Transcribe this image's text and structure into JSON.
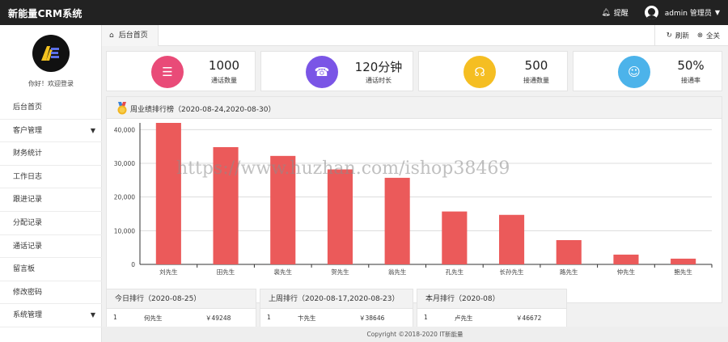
{
  "app": {
    "title": "新能量CRM系统"
  },
  "topbar": {
    "notice_label": "提醒",
    "user_label": "admin 管理员"
  },
  "sidebar": {
    "welcome": "你好！欢迎登录",
    "items": [
      {
        "label": "后台首页",
        "has_arrow": false
      },
      {
        "label": "客户管理",
        "has_arrow": true
      },
      {
        "label": "财务统计",
        "has_arrow": false
      },
      {
        "label": "工作日志",
        "has_arrow": false
      },
      {
        "label": "跟进记录",
        "has_arrow": false
      },
      {
        "label": "分配记录",
        "has_arrow": false
      },
      {
        "label": "通话记录",
        "has_arrow": false
      },
      {
        "label": "留言板",
        "has_arrow": false
      },
      {
        "label": "修改密码",
        "has_arrow": false
      },
      {
        "label": "系统管理",
        "has_arrow": true
      }
    ]
  },
  "tabs": {
    "home": "后台首页",
    "refresh": "刷新",
    "close_all": "全关"
  },
  "stats": [
    {
      "value": "1000",
      "label": "通话数量",
      "color": "#e94b78",
      "icon": "document-icon"
    },
    {
      "value": "120分钟",
      "label": "通话时长",
      "color": "#7a55e6",
      "icon": "phone-icon"
    },
    {
      "value": "500",
      "label": "接通数量",
      "color": "#f5be22",
      "icon": "headset-icon"
    },
    {
      "value": "50%",
      "label": "接通率",
      "color": "#4cb3ea",
      "icon": "user-card-icon"
    }
  ],
  "chart_panel": {
    "title": "周业绩排行榜（2020-08-24,2020-08-30）"
  },
  "chart_data": {
    "type": "bar",
    "categories": [
      "刘先生",
      "田先生",
      "裴先生",
      "贺先生",
      "翁先生",
      "孔先生",
      "长孙先生",
      "路先生",
      "仲先生",
      "鲍先生"
    ],
    "values": [
      42000,
      34800,
      32200,
      28200,
      25700,
      15700,
      14700,
      7200,
      2900,
      1700
    ],
    "ylim": [
      0,
      42000
    ],
    "yticks": [
      0,
      10000,
      20000,
      30000,
      40000
    ],
    "ytick_labels": [
      "0",
      "10,000",
      "20,000",
      "30,000",
      "40,000"
    ],
    "bar_color": "#eb5a5a",
    "grid": true
  },
  "rankings": [
    {
      "title": "今日排行（2020-08-25）",
      "rank": "1",
      "name": "何先生",
      "amount": "￥49248"
    },
    {
      "title": "上周排行（2020-08-17,2020-08-23）",
      "rank": "1",
      "name": "卞先生",
      "amount": "￥38646"
    },
    {
      "title": "本月排行（2020-08）",
      "rank": "1",
      "name": "卢先生",
      "amount": "￥46672"
    }
  ],
  "footer": {
    "text": "Copyright ©2018-2020 IT新能量"
  },
  "watermark": {
    "text": "https://www.huzhan.com/ishop38469"
  }
}
